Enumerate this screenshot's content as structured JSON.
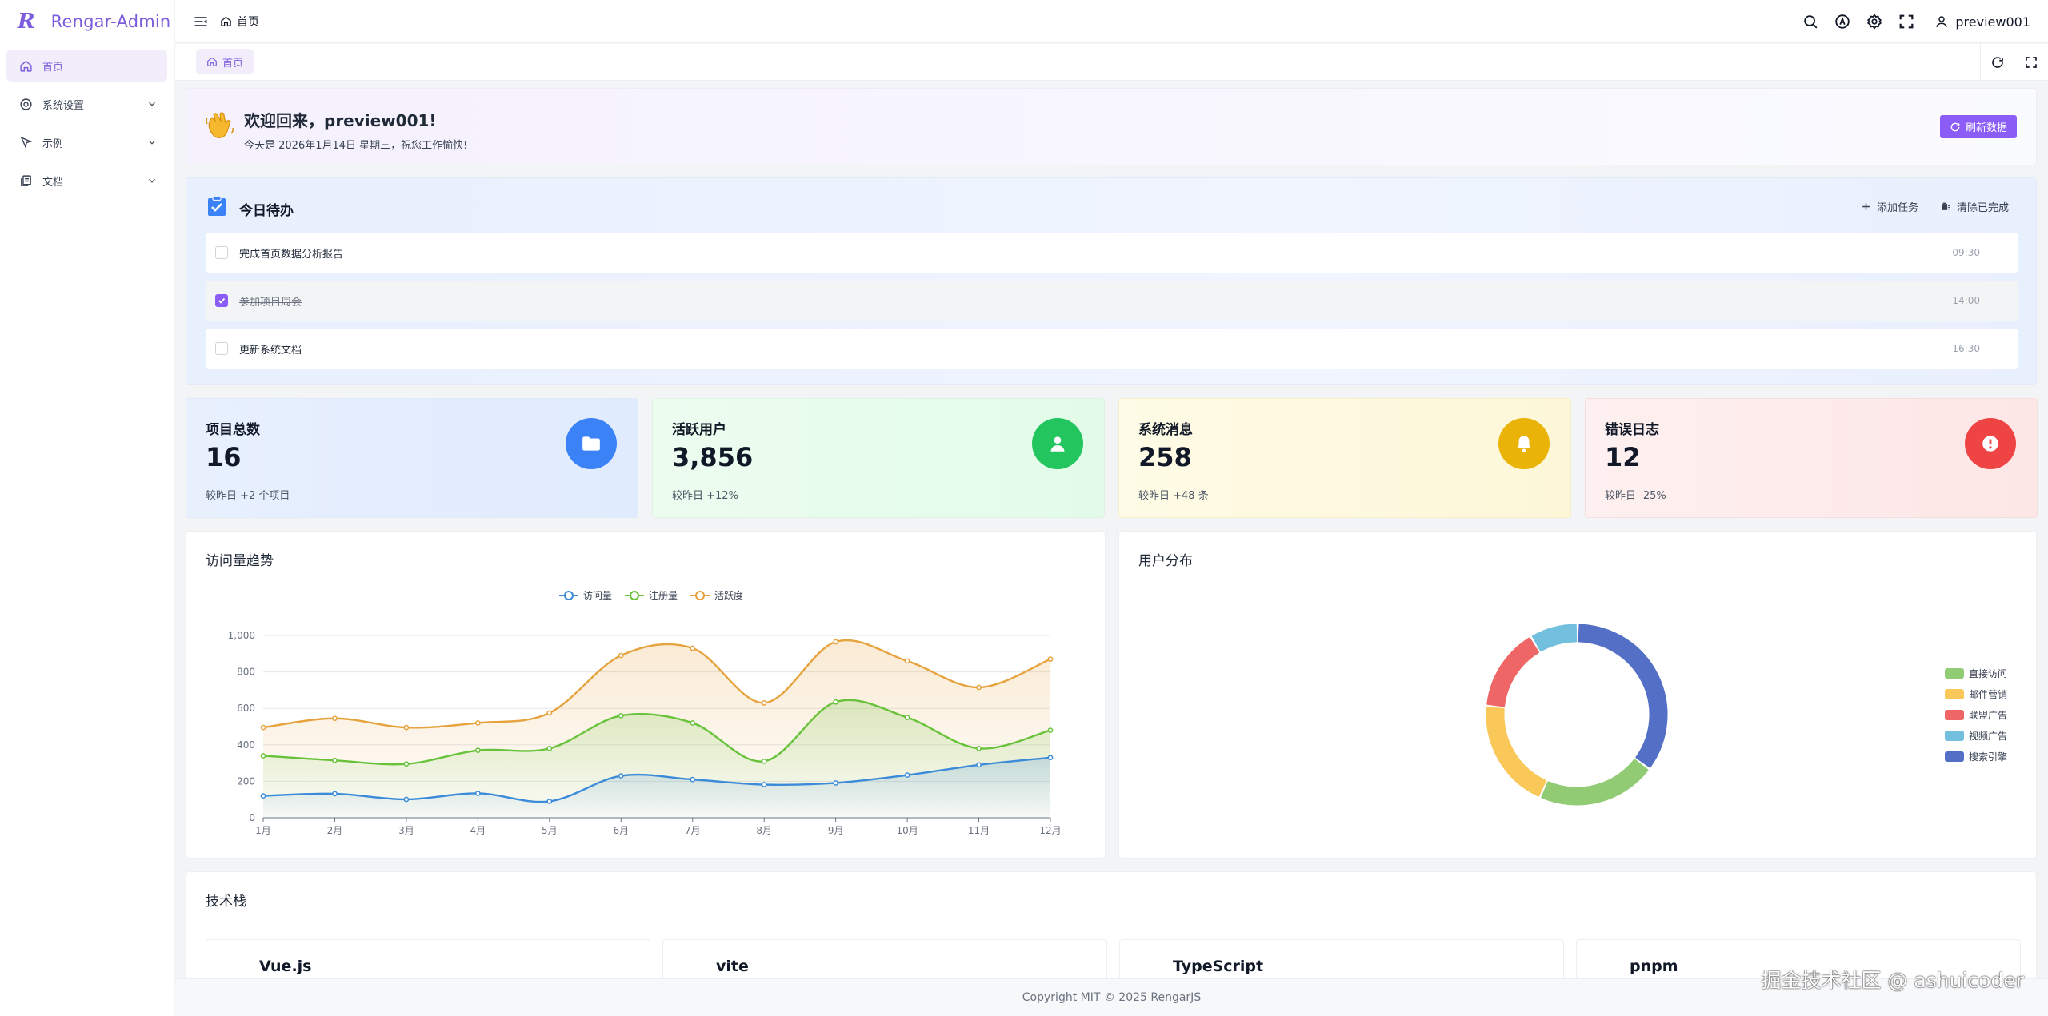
{
  "app": {
    "logo_letter": "R",
    "title": "Rengar-Admin"
  },
  "sidebar": {
    "items": [
      {
        "label": "首页",
        "icon": "home-icon",
        "active": true
      },
      {
        "label": "系统设置",
        "icon": "settings-icon"
      },
      {
        "label": "示例",
        "icon": "cursor-icon"
      },
      {
        "label": "文档",
        "icon": "document-icon"
      }
    ]
  },
  "header": {
    "breadcrumb": "首页",
    "username": "preview001"
  },
  "tabs": [
    {
      "label": "首页"
    }
  ],
  "welcome": {
    "title": "欢迎回来，preview001!",
    "subtitle": "今天是 2026年1月14日 星期三，祝您工作愉快!",
    "refresh_label": "刷新数据"
  },
  "todo": {
    "title": "今日待办",
    "add_label": "添加任务",
    "clear_label": "清除已完成",
    "items": [
      {
        "text": "完成首页数据分析报告",
        "time": "09:30",
        "done": false
      },
      {
        "text": "参加项目周会",
        "time": "14:00",
        "done": true
      },
      {
        "text": "更新系统文档",
        "time": "16:30",
        "done": false
      }
    ]
  },
  "stats": [
    {
      "label": "项目总数",
      "value": "16",
      "compare": "较昨日 +2 个项目",
      "color": "#3b82f6",
      "icon": "folder-icon"
    },
    {
      "label": "活跃用户",
      "value": "3,856",
      "compare": "较昨日 +12%",
      "color": "#22c55e",
      "icon": "user-icon"
    },
    {
      "label": "系统消息",
      "value": "258",
      "compare": "较昨日 +48 条",
      "color": "#eab308",
      "icon": "bell-icon"
    },
    {
      "label": "错误日志",
      "value": "12",
      "compare": "较昨日 -25%",
      "color": "#ef4444",
      "icon": "alert-icon"
    }
  ],
  "panels": {
    "trend_title": "访问量趋势",
    "dist_title": "用户分布"
  },
  "chart_data": [
    {
      "type": "line",
      "title": "访问量趋势",
      "categories": [
        "1月",
        "2月",
        "3月",
        "4月",
        "5月",
        "6月",
        "7月",
        "8月",
        "9月",
        "10月",
        "11月",
        "12月"
      ],
      "ylim": [
        0,
        1000
      ],
      "yticks": [
        "0",
        "200",
        "400",
        "600",
        "800",
        "1,000"
      ],
      "grid": true,
      "legend": "top-center",
      "series": [
        {
          "name": "访问量",
          "color": "#3b8bd9",
          "values": [
            120,
            132,
            101,
            134,
            90,
            230,
            210,
            182,
            191,
            234,
            290,
            330
          ]
        },
        {
          "name": "注册量",
          "color": "#67c23a",
          "values": [
            340,
            315,
            295,
            370,
            380,
            560,
            520,
            310,
            635,
            550,
            380,
            480
          ]
        },
        {
          "name": "活跃度",
          "color": "#e6a23c",
          "values": [
            495,
            545,
            495,
            520,
            575,
            890,
            930,
            630,
            965,
            860,
            715,
            870
          ]
        }
      ]
    },
    {
      "type": "pie",
      "title": "用户分布",
      "legend": "right",
      "series": [
        {
          "name": "直接访问",
          "color": "#91cc75",
          "value": 335
        },
        {
          "name": "邮件营销",
          "color": "#fac858",
          "value": 310
        },
        {
          "name": "联盟广告",
          "color": "#ee6666",
          "value": 234
        },
        {
          "name": "视频广告",
          "color": "#73c0de",
          "value": 135
        },
        {
          "name": "搜索引擎",
          "color": "#5470c6",
          "value": 548
        }
      ]
    }
  ],
  "techstack": {
    "title": "技术栈",
    "items": [
      "Vue.js",
      "vite",
      "TypeScript",
      "pnpm"
    ]
  },
  "footer": {
    "copyright": "Copyright MIT © 2025 RengarJS"
  },
  "watermark": "掘金技术社区 @ ashuicoder"
}
